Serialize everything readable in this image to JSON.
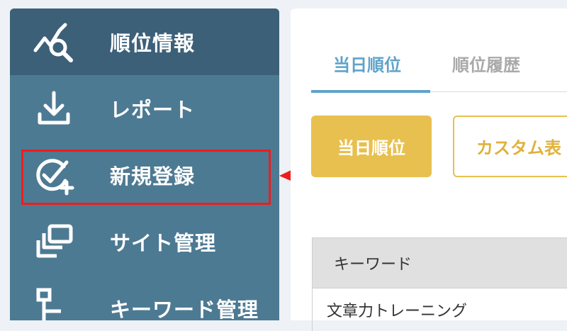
{
  "sidebar": {
    "items": [
      {
        "label": "順位情報",
        "icon": "rank-search-icon",
        "active": true
      },
      {
        "label": "レポート",
        "icon": "download-icon"
      },
      {
        "label": "新規登録",
        "icon": "check-add-icon",
        "highlighted": true
      },
      {
        "label": "サイト管理",
        "icon": "sites-icon"
      },
      {
        "label": "キーワード管理",
        "icon": "keyword-tree-icon"
      }
    ]
  },
  "main": {
    "tabs": [
      {
        "label": "当日順位",
        "active": true
      },
      {
        "label": "順位履歴"
      }
    ],
    "buttons": {
      "primary": "当日順位",
      "secondary": "カスタム表"
    },
    "table": {
      "header": "キーワード",
      "first_row": "文章力トレーニング"
    }
  },
  "colors": {
    "sidebar": "#4d7a93",
    "sidebar_active": "#3d6079",
    "accent_blue": "#5fa3c9",
    "accent_yellow": "#e8c04f",
    "annotation_red": "#ee1d1d"
  }
}
